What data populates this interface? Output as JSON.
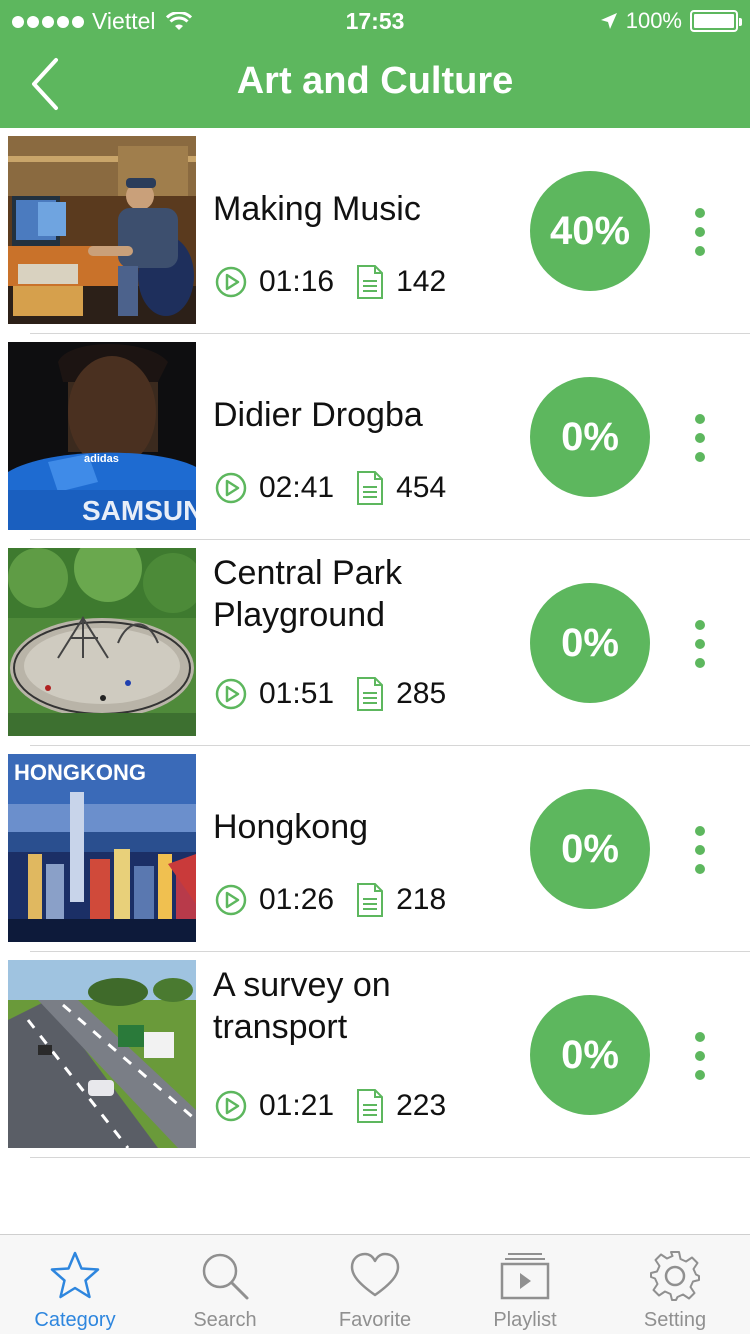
{
  "status_bar": {
    "carrier": "Viettel",
    "time": "17:53",
    "battery": "100%"
  },
  "nav": {
    "title": "Art and Culture",
    "back_icon": "chevron-left-icon"
  },
  "items": [
    {
      "title": "Making Music",
      "duration": "01:16",
      "count": "142",
      "progress": "40%",
      "thumbnail": "recording-studio"
    },
    {
      "title": "Didier Drogba",
      "duration": "02:41",
      "count": "454",
      "progress": "0%",
      "thumbnail": "footballer-portrait"
    },
    {
      "title": "Central Park Playground",
      "duration": "01:51",
      "count": "285",
      "progress": "0%",
      "thumbnail": "playground"
    },
    {
      "title": "Hongkong",
      "duration": "01:26",
      "count": "218",
      "progress": "0%",
      "thumbnail": "hongkong-skyline",
      "thumbnail_caption": "HONGKONG"
    },
    {
      "title": "A survey on transport",
      "duration": "01:21",
      "count": "223",
      "progress": "0%",
      "thumbnail": "highway"
    }
  ],
  "tabs": [
    {
      "label": "Category",
      "icon": "star-icon",
      "active": true
    },
    {
      "label": "Search",
      "icon": "search-icon",
      "active": false
    },
    {
      "label": "Favorite",
      "icon": "heart-icon",
      "active": false
    },
    {
      "label": "Playlist",
      "icon": "playlist-icon",
      "active": false
    },
    {
      "label": "Setting",
      "icon": "gear-icon",
      "active": false
    }
  ],
  "colors": {
    "accent": "#5db75e",
    "tab_active": "#2e86de",
    "tab_inactive": "#909090"
  }
}
